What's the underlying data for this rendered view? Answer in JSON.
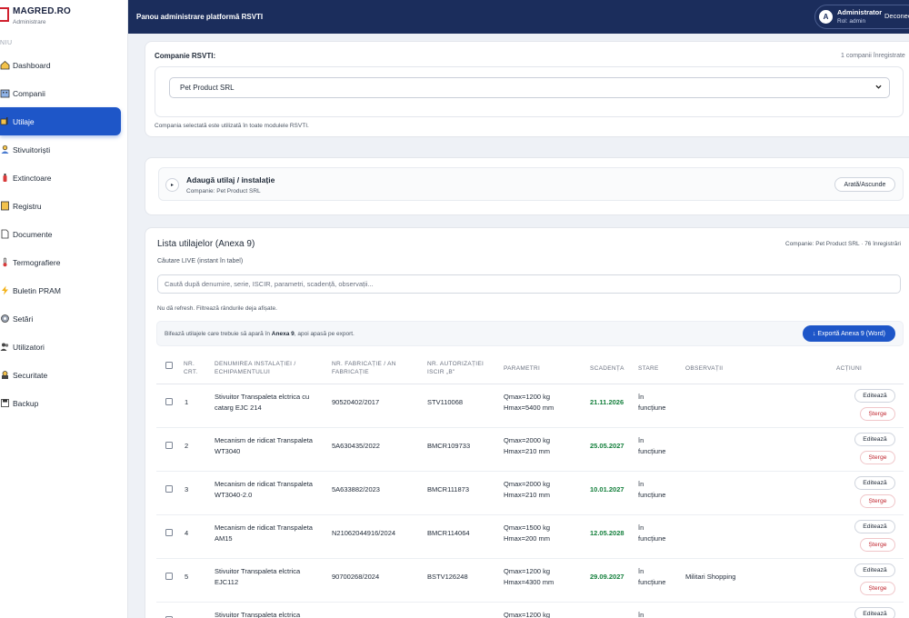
{
  "brand": {
    "name": "MAGRED.RO",
    "subtitle": "Administrare",
    "menu_heading": "NIU"
  },
  "sidebar": {
    "items": [
      {
        "label": "Dashboard",
        "icon": "home-icon",
        "active": false
      },
      {
        "label": "Companii",
        "icon": "building-icon",
        "active": false
      },
      {
        "label": "Utilaje",
        "icon": "machine-icon",
        "active": true
      },
      {
        "label": "Stivuitoriști",
        "icon": "person-icon",
        "active": false
      },
      {
        "label": "Extinctoare",
        "icon": "fire-extinguisher-icon",
        "active": false
      },
      {
        "label": "Registru",
        "icon": "ledger-icon",
        "active": false
      },
      {
        "label": "Documente",
        "icon": "document-icon",
        "active": false
      },
      {
        "label": "Termografiere",
        "icon": "thermometer-icon",
        "active": false
      },
      {
        "label": "Buletin PRAM",
        "icon": "lightning-icon",
        "active": false
      },
      {
        "label": "Setări",
        "icon": "gear-icon",
        "active": false
      },
      {
        "label": "Utilizatori",
        "icon": "users-icon",
        "active": false
      },
      {
        "label": "Securitate",
        "icon": "shield-icon",
        "active": false
      },
      {
        "label": "Backup",
        "icon": "backup-icon",
        "active": false
      }
    ]
  },
  "topbar": {
    "title": "Panou administrare platformă RSVTI",
    "user_initial": "A",
    "user_name": "Administrator",
    "user_role": "Rol: admin",
    "logout_label": "Deconectare"
  },
  "company_card": {
    "label": "Companie RSVTI:",
    "count_text": "1 companii înregistrate",
    "selected": "Pet Product SRL",
    "help_text": "Compania selectată este utilizată în toate modulele RSVTI."
  },
  "add_card": {
    "title": "Adaugă utilaj / instalație",
    "subtitle": "Companie: Pet Product SRL",
    "toggle_label": "Arată/Ascunde",
    "play_glyph": "▸"
  },
  "list_card": {
    "title": "Lista utilajelor (Anexa 9)",
    "company_info": "Companie: Pet Product SRL · 76 înregistrări",
    "search_label": "Căutare LIVE (instant în tabel)",
    "search_placeholder": "Caută după denumire, serie, ISCIR, parametri, scadență, observații...",
    "search_value": "",
    "hint": "Nu dă refresh. Filtrează rândurile deja afișate.",
    "export_text_pre": "Bifează utilajele care trebuie să apară în ",
    "export_text_bold": "Anexa 9",
    "export_text_post": ", apoi apasă pe export.",
    "export_button": "↓ Exportă Anexa 9 (Word)"
  },
  "table": {
    "headers": {
      "nr_1": "NR.",
      "nr_2": "CRT.",
      "name_1": "DENUMIREA INSTALAȚIEI /",
      "name_2": "ECHIPAMENTULUI",
      "fab_1": "NR. FABRICAȚIE / AN",
      "fab_2": "FABRICAȚIE",
      "auth_1": "NR. AUTORIZAȚIEI",
      "auth_2": "ISCIR „B\"",
      "params": "PARAMETRI",
      "due": "SCADENȚA",
      "state": "STARE",
      "obs": "OBSERVAȚII",
      "actions": "ACȚIUNI"
    },
    "edit_label": "Editează",
    "delete_label": "Șterge",
    "rows": [
      {
        "nr": "1",
        "name_1": "Stivuitor Transpaleta elctrica cu",
        "name_2": "catarg EJC 214",
        "fab": "90520402/2017",
        "auth": "STV110068",
        "param_1": "Qmax=1200 kg",
        "param_2": "Hmax=5400 mm",
        "due": "21.11.2026",
        "state_1": "în",
        "state_2": "funcțiune",
        "obs": ""
      },
      {
        "nr": "2",
        "name_1": "Mecanism de ridicat Transpaleta",
        "name_2": "WT3040",
        "fab": "5A630435/2022",
        "auth": "BMCR109733",
        "param_1": "Qmax=2000 kg",
        "param_2": "Hmax=210 mm",
        "due": "25.05.2027",
        "state_1": "în",
        "state_2": "funcțiune",
        "obs": ""
      },
      {
        "nr": "3",
        "name_1": "Mecanism de ridicat Transpaleta",
        "name_2": "WT3040-2.0",
        "fab": "5A633882/2023",
        "auth": "BMCR111873",
        "param_1": "Qmax=2000 kg",
        "param_2": "Hmax=210 mm",
        "due": "10.01.2027",
        "state_1": "în",
        "state_2": "funcțiune",
        "obs": ""
      },
      {
        "nr": "4",
        "name_1": "Mecanism de ridicat Transpaleta",
        "name_2": "AM15",
        "fab": "N21062044916/2024",
        "auth": "BMCR114064",
        "param_1": "Qmax=1500 kg",
        "param_2": "Hmax=200 mm",
        "due": "12.05.2028",
        "state_1": "în",
        "state_2": "funcțiune",
        "obs": ""
      },
      {
        "nr": "5",
        "name_1": "Stivuitor Transpaleta elctrica",
        "name_2": "EJC112",
        "fab": "90700268/2024",
        "auth": "BSTV126248",
        "param_1": "Qmax=1200 kg",
        "param_2": "Hmax=4300 mm",
        "due": "29.09.2027",
        "state_1": "în",
        "state_2": "funcțiune",
        "obs": "Militari Shopping"
      },
      {
        "nr": "",
        "name_1": "Stivuitor Transpaleta elctrica",
        "name_2": "",
        "fab": "",
        "auth": "",
        "param_1": "Qmax=1200 kg",
        "param_2": "",
        "due": "",
        "state_1": "în",
        "state_2": "",
        "obs": ""
      }
    ]
  },
  "colors": {
    "accent": "#1e56c8",
    "topbar": "#1b2d5c",
    "date_green": "#15803d",
    "danger": "#c0262f"
  }
}
